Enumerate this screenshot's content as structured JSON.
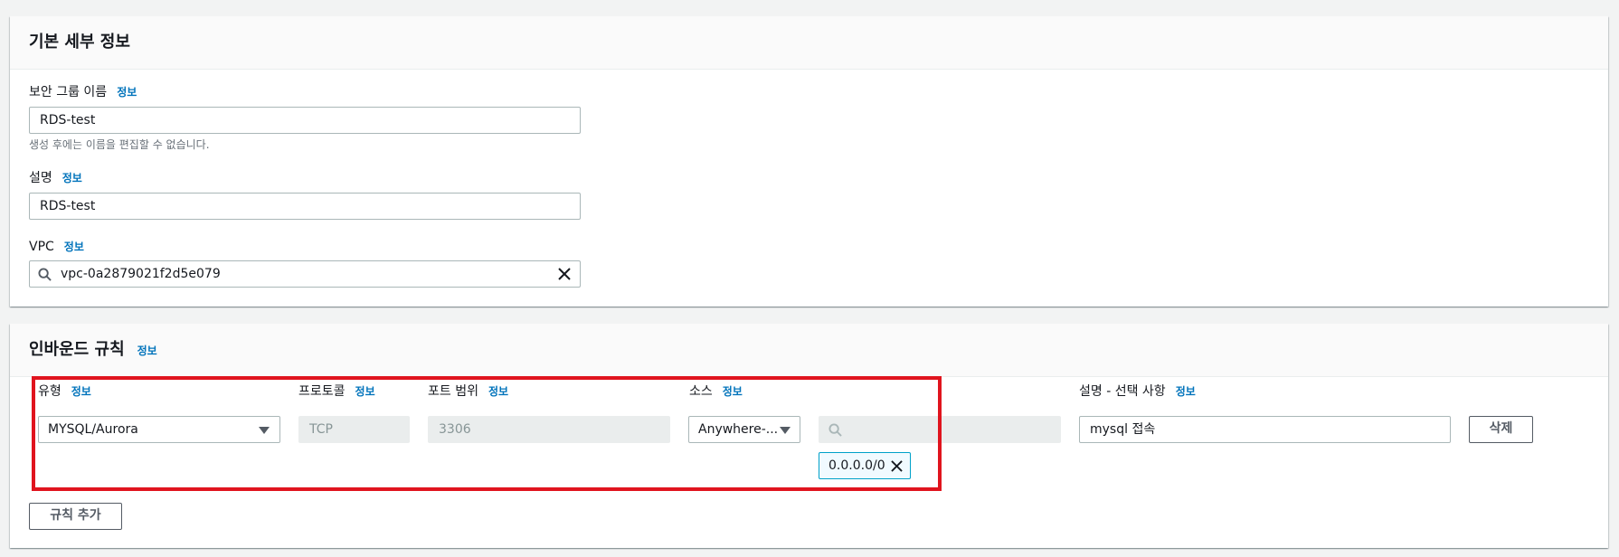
{
  "basic": {
    "title": "기본 세부 정보",
    "name_label": "보안 그룹 이름",
    "name_info": "정보",
    "name_value": "RDS-test",
    "name_hint": "생성 후에는 이름을 편집할 수 없습니다.",
    "desc_label": "설명",
    "desc_info": "정보",
    "desc_value": "RDS-test",
    "vpc_label": "VPC",
    "vpc_info": "정보",
    "vpc_value": "vpc-0a2879021f2d5e079"
  },
  "inbound": {
    "title": "인바운드 규칙",
    "title_info": "정보",
    "columns": {
      "type": "유형",
      "protocol": "프로토콜",
      "port_range": "포트 범위",
      "source": "소스",
      "description": "설명 - 선택 사항",
      "info": "정보"
    },
    "rule": {
      "type_value": "MYSQL/Aurora",
      "protocol_value": "TCP",
      "port_value": "3306",
      "source_value": "Anywhere-...",
      "cidr_token": "0.0.0.0/0",
      "description_value": "mysql 접속",
      "delete_label": "삭제"
    },
    "add_rule_label": "규칙 추가"
  },
  "colors": {
    "link": "#0073bb",
    "highlight": "#e0141e",
    "token_border": "#00a1c9"
  }
}
